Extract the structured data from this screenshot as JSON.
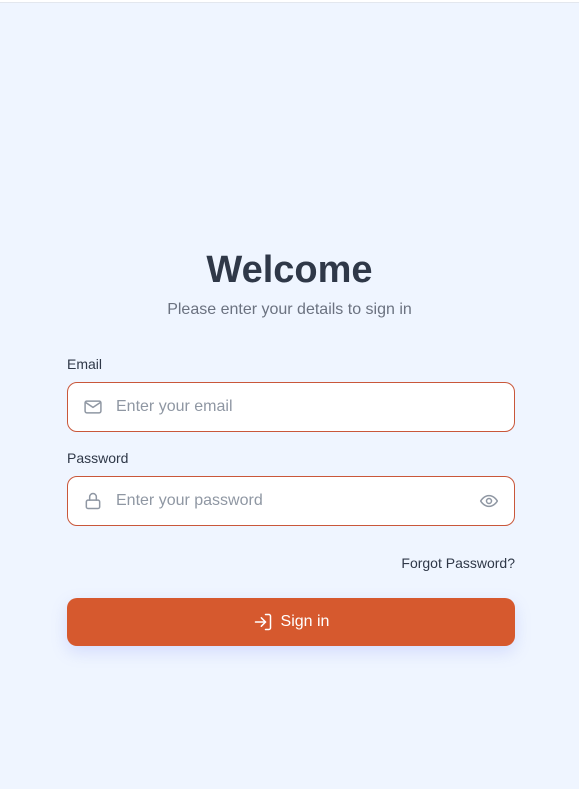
{
  "header": {
    "title": "Welcome",
    "subtitle": "Please enter your details to sign in"
  },
  "form": {
    "email": {
      "label": "Email",
      "placeholder": "Enter your email",
      "value": "",
      "icon": "mail-icon"
    },
    "password": {
      "label": "Password",
      "placeholder": "Enter your password",
      "value": "",
      "icon": "lock-icon",
      "toggle_icon": "eye-icon"
    },
    "forgot_label": "Forgot Password?",
    "submit_label": "Sign in",
    "submit_icon": "log-in-icon"
  },
  "colors": {
    "background": "#eff5ff",
    "accent": "#d6592e",
    "field_border": "#c9573a",
    "heading": "#2f3848",
    "muted": "#6b7280"
  }
}
